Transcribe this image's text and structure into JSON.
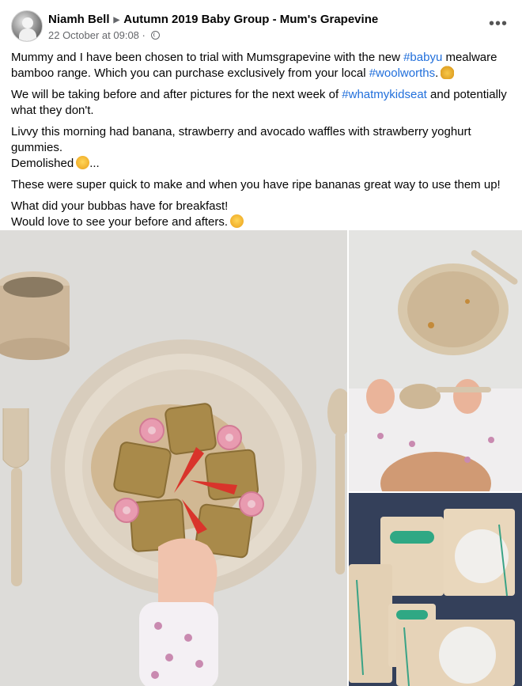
{
  "post": {
    "author": "Niamh Bell",
    "group": "Autumn 2019 Baby Group - Mum's Grapevine",
    "timestamp": "22 October at 09:08",
    "separator": "·",
    "more_label": "•••",
    "paragraphs": {
      "p1": {
        "a": "Mummy and I have been chosen to trial with Mumsgrapevine with the new ",
        "tag1": "#babyu",
        "b": " mealware bamboo range. Which you can purchase exclusively from your local ",
        "tag2": "#woolworths",
        "c": "."
      },
      "p2": {
        "a": "We will be taking before and after pictures for the next week of ",
        "tag1": "#whatmykidseat",
        "b": " and potentially what they don't."
      },
      "p3": {
        "line1": "Livvy this morning had banana, strawberry and avocado waffles with strawberry yoghurt gummies.",
        "line2": "Demolished",
        "line2_end": "..."
      },
      "p4": "These were super quick to make and when you have ripe bananas great way to use them up!",
      "p5": {
        "line1": "What did your bubbas have for breakfast!",
        "line2": "Would love to see your before and afters."
      }
    }
  },
  "icons": {
    "avatar": "profile-photo",
    "arrow": "triangle-right-icon",
    "privacy": "globe-icon",
    "more": "more-options-icon",
    "emoji1": "victory-hand-emoji",
    "emoji2": "laughing-emoji",
    "emoji3": "hugging-emoji"
  },
  "colors": {
    "hashtag": "#216fdb",
    "secondary_text": "#65676b"
  }
}
